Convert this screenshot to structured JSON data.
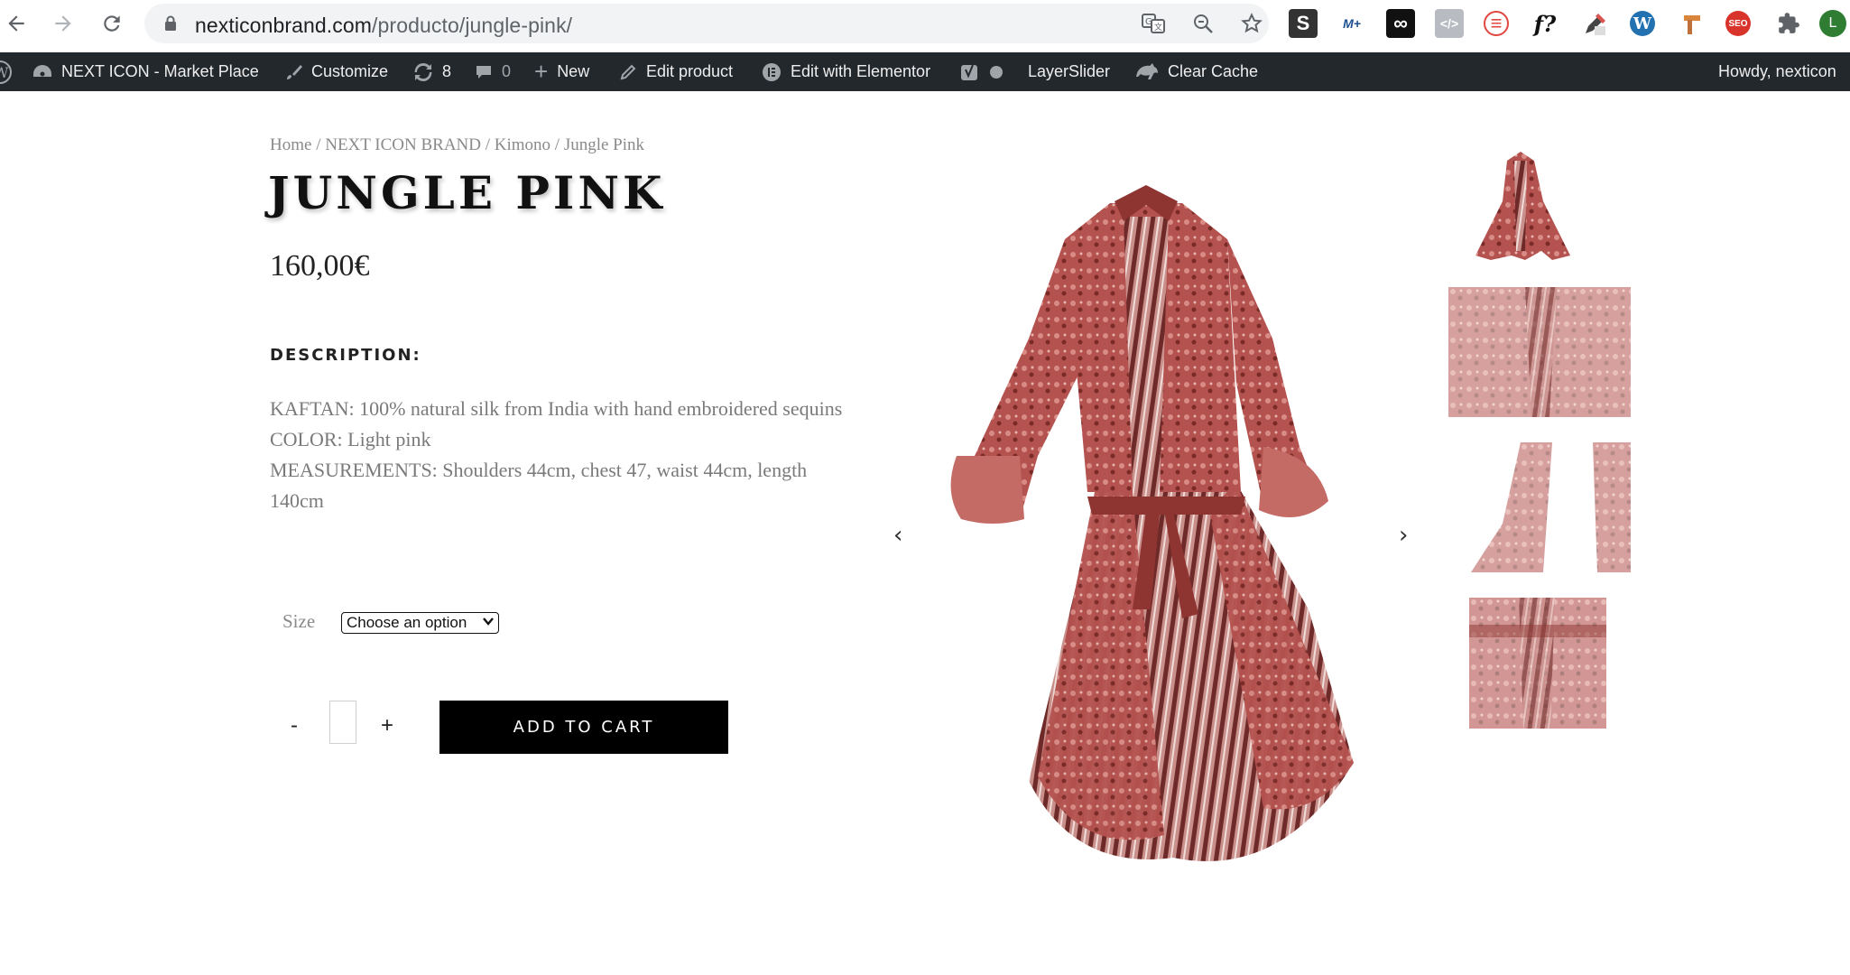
{
  "browser": {
    "url_host": "nexticonbrand.com",
    "url_path": "/producto/jungle-pink/",
    "back_icon": "arrow-left-icon",
    "forward_icon": "arrow-right-icon",
    "reload_icon": "reload-icon",
    "extensions": [
      "S",
      "M+",
      "∞",
      "</>",
      "≡",
      "f?",
      "W",
      "SEO",
      "L"
    ]
  },
  "admin_bar": {
    "site_name": "NEXT ICON - Market Place",
    "customize": "Customize",
    "updates_count": "8",
    "comments_count": "0",
    "new": "New",
    "edit_product": "Edit product",
    "edit_elementor": "Edit with Elementor",
    "layerslider": "LayerSlider",
    "clear_cache": "Clear Cache",
    "howdy": "Howdy, nexticon"
  },
  "breadcrumb": {
    "home": "Home",
    "brand": "NEXT ICON BRAND",
    "category": "Kimono",
    "current": "Jungle Pink",
    "separator": "/"
  },
  "product": {
    "title": "JUNGLE PINK",
    "price": "160,00€",
    "description_heading": "DESCRIPTION:",
    "description_lines": [
      "KAFTAN: 100% natural silk from India with hand embroidered sequins",
      "COLOR: Light pink",
      "MEASUREMENTS: Shoulders 44cm, chest 47, waist 44cm, length 140cm"
    ],
    "size_label": "Size",
    "size_select_value": "Choose an option",
    "qty_minus": "-",
    "qty_plus": "+",
    "add_to_cart": "ADD TO CART"
  },
  "gallery": {
    "prev_arrow": "‹",
    "next_arrow": "›"
  },
  "colors": {
    "admin_bar_bg": "#23282d",
    "button_bg": "#000000",
    "dress_red": "#b4524f"
  }
}
